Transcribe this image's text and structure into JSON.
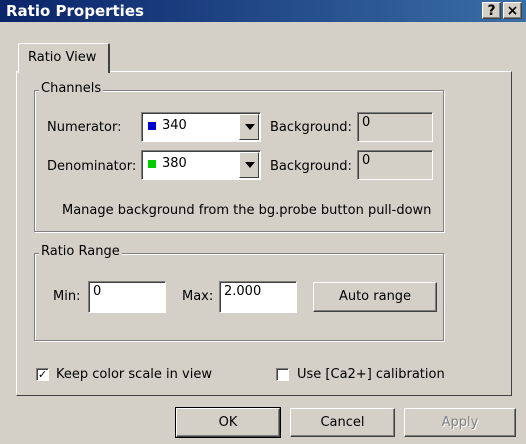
{
  "window": {
    "title": "Ratio Properties",
    "help_glyph": "?",
    "close_glyph": "×"
  },
  "tabs": [
    {
      "label": "Ratio View"
    }
  ],
  "channels": {
    "group_label": "Channels",
    "numerator": {
      "label": "Numerator:",
      "value": "340",
      "swatch_color": "#0000cc",
      "background_label": "Background:",
      "background_value": "0"
    },
    "denominator": {
      "label": "Denominator:",
      "value": "380",
      "swatch_color": "#00cc00",
      "background_label": "Background:",
      "background_value": "0"
    },
    "note": "Manage background from the bg.probe button pull-down"
  },
  "ratio_range": {
    "group_label": "Ratio Range",
    "min_label": "Min:",
    "min_value": "0",
    "max_label": "Max:",
    "max_value": "2.000",
    "auto_range_label": "Auto range"
  },
  "options": {
    "keep_color_scale": {
      "label": "Keep color scale in view",
      "checked": true,
      "check_glyph": "✓"
    },
    "use_calibration": {
      "label": "Use [Ca2+] calibration",
      "checked": false,
      "check_glyph": ""
    }
  },
  "buttons": {
    "ok": "OK",
    "cancel": "Cancel",
    "apply": "Apply"
  }
}
